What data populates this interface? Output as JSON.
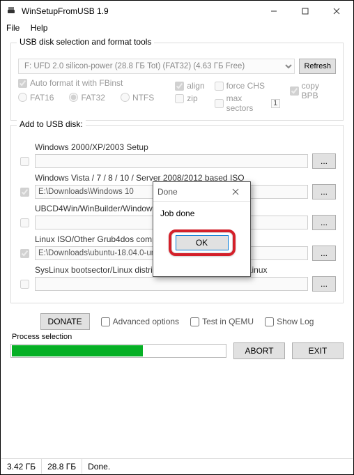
{
  "window": {
    "title": "WinSetupFromUSB 1.9",
    "minimize": "—",
    "maximize": "☐",
    "close": "✕"
  },
  "menu": {
    "file": "File",
    "help": "Help"
  },
  "group1": {
    "legend": "USB disk selection and format tools",
    "drive": "F: UFD 2.0 silicon-power (28.8 ГБ Tot) (FAT32) (4.63 ГБ Free)",
    "refresh": "Refresh",
    "autoformat": "Auto format it with FBinst",
    "align": "align",
    "forceCHS": "force CHS",
    "copyBPB": "copy BPB",
    "fat16": "FAT16",
    "fat32": "FAT32",
    "ntfs": "NTFS",
    "zip": "zip",
    "maxsectors": "max sectors",
    "maxsectors_val": "1"
  },
  "group2": {
    "legend": "Add to USB disk:",
    "r1_label": "Windows 2000/XP/2003 Setup",
    "r1_path": "",
    "r2_label": "Windows Vista / 7 / 8 / 10 / Server 2008/2012 based ISO",
    "r2_path": "E:\\Downloads\\Windows 10",
    "r3_label": "UBCD4Win/WinBuilder/Windows FLPC setup",
    "r3_path": "",
    "r4_label": "Linux ISO/Other Grub4dos compatible ISO",
    "r4_path": "E:\\Downloads\\ubuntu-18.04.0-unity-06.07.2018.iso",
    "r5_label": "SysLinux bootsector/Linux distribution using SysLinux/IsoLinux",
    "r5_path": "",
    "browse": "..."
  },
  "bottom": {
    "donate": "DONATE",
    "advanced": "Advanced options",
    "testqemu": "Test in QEMU",
    "showlog": "Show Log",
    "process": "Process selection",
    "abort": "ABORT",
    "exit": "EXIT"
  },
  "status": {
    "a": "3.42 ГБ",
    "b": "28.8 ГБ",
    "c": "Done."
  },
  "modal": {
    "title": "Done",
    "body": "Job done",
    "ok": "OK"
  }
}
